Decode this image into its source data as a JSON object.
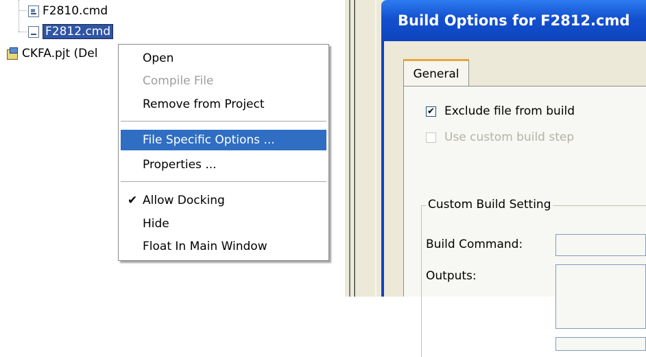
{
  "tree": {
    "items": [
      {
        "label": "F2810.cmd"
      },
      {
        "label": "F2812.cmd"
      },
      {
        "label": "CKFA.pjt (Del"
      }
    ]
  },
  "context_menu": {
    "items": [
      {
        "label": "Open",
        "state": "enabled"
      },
      {
        "label": "Compile File",
        "state": "disabled"
      },
      {
        "label": "Remove from Project",
        "state": "enabled"
      },
      {
        "label": "File Specific Options ...",
        "state": "highlighted"
      },
      {
        "label": "Properties ...",
        "state": "enabled"
      },
      {
        "label": "Allow Docking",
        "state": "checked"
      },
      {
        "label": "Hide",
        "state": "enabled"
      },
      {
        "label": "Float In Main Window",
        "state": "enabled"
      }
    ],
    "check_glyph": "✔"
  },
  "dialog": {
    "title": "Build Options for F2812.cmd",
    "tab_label": "General",
    "exclude_label": "Exclude file from build",
    "exclude_checked": true,
    "check_glyph": "✔",
    "custom_step_label": "Use custom build step",
    "custom_step_checked": false,
    "group_label": "Custom Build Setting",
    "build_command_label": "Build Command:",
    "build_command_value": "",
    "outputs_label": "Outputs:",
    "outputs_value": ""
  },
  "colors": {
    "selection": "#2f55a4",
    "menu_highlight": "#2f6ec2",
    "titlebar": "#1350cf",
    "dialog_bg": "#ece9d8"
  }
}
